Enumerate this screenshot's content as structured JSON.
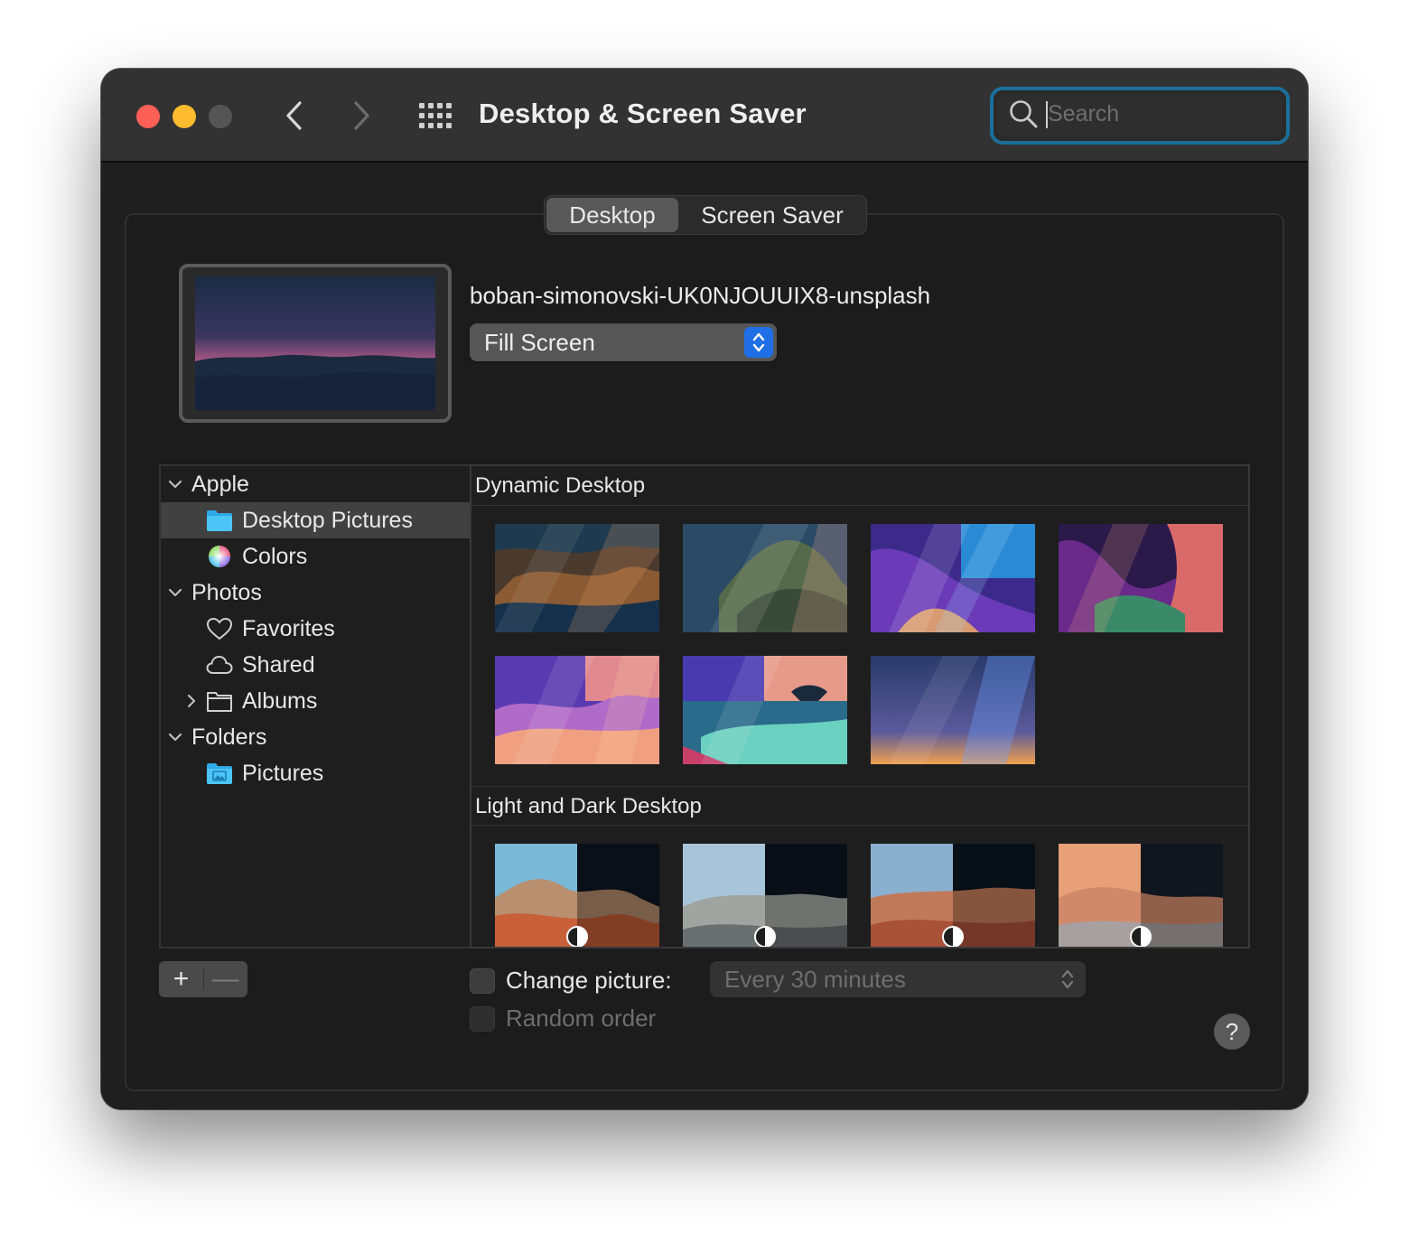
{
  "window": {
    "title": "Desktop & Screen Saver"
  },
  "search": {
    "placeholder": "Search",
    "value": ""
  },
  "tabs": [
    {
      "label": "Desktop",
      "active": true
    },
    {
      "label": "Screen Saver",
      "active": false
    }
  ],
  "current": {
    "file_name": "boban-simonovski-UK0NJOUUIX8-unsplash",
    "fit": "Fill Screen"
  },
  "sidebar": {
    "groups": [
      {
        "label": "Apple",
        "expanded": true,
        "items": [
          {
            "label": "Desktop Pictures",
            "icon": "folder-icon",
            "selected": true
          },
          {
            "label": "Colors",
            "icon": "color-wheel-icon",
            "selected": false
          }
        ]
      },
      {
        "label": "Photos",
        "expanded": true,
        "items": [
          {
            "label": "Favorites",
            "icon": "heart-icon",
            "selected": false
          },
          {
            "label": "Shared",
            "icon": "cloud-icon",
            "selected": false
          },
          {
            "label": "Albums",
            "icon": "folder-icon",
            "selected": false,
            "collapsed": true
          }
        ]
      },
      {
        "label": "Folders",
        "expanded": true,
        "items": [
          {
            "label": "Pictures",
            "icon": "pictures-folder-icon",
            "selected": false
          }
        ]
      }
    ]
  },
  "gallery": {
    "sections": [
      {
        "title": "Dynamic Desktop"
      },
      {
        "title": "Light and Dark Desktop"
      }
    ]
  },
  "controls": {
    "add_label": "+",
    "remove_label": "—",
    "change_picture_label": "Change picture:",
    "change_picture_checked": false,
    "interval": "Every 30 minutes",
    "random_order_label": "Random order",
    "random_order_checked": false,
    "help_label": "?"
  },
  "colors": {
    "accent": "#1f6fe6",
    "search_focus": "#1b6f9a",
    "close": "#fe5f57",
    "minimize": "#febc2e"
  }
}
